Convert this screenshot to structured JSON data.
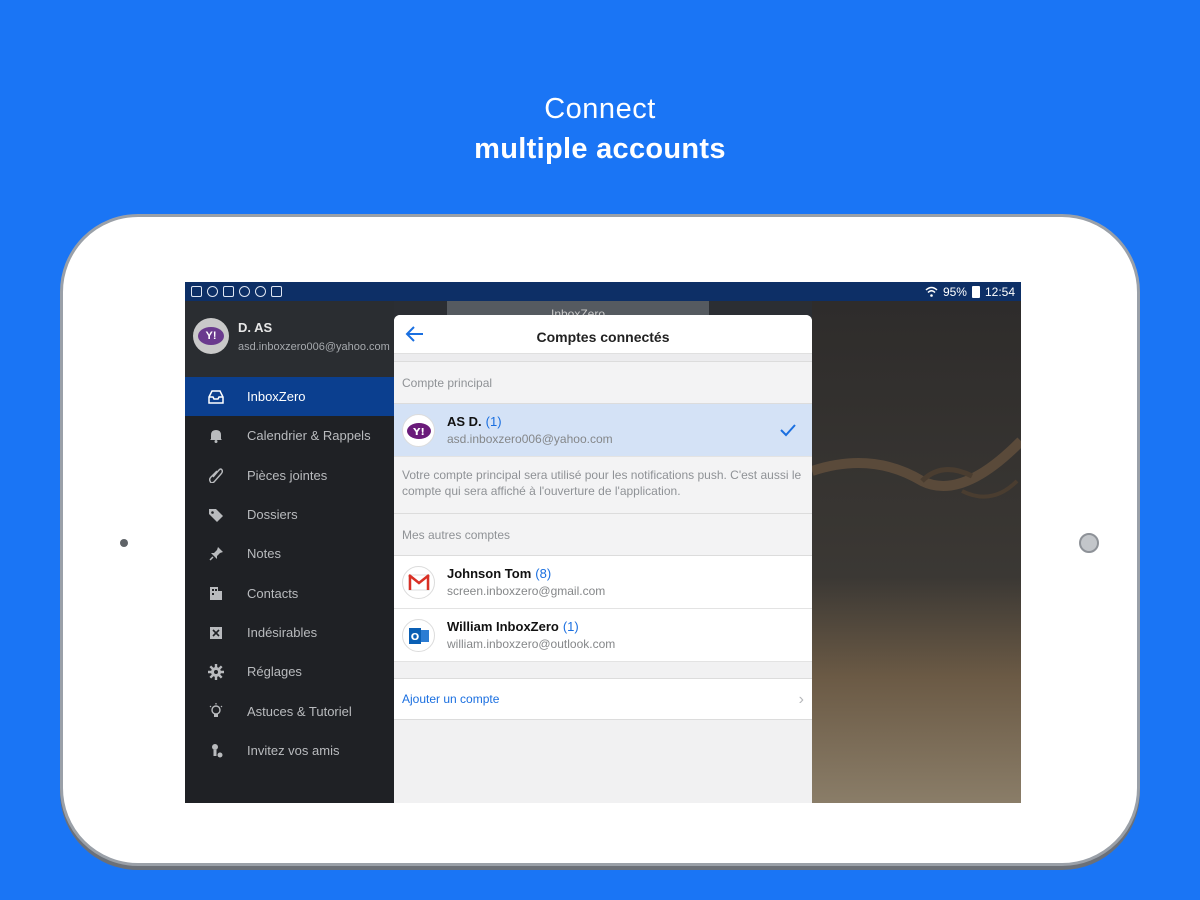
{
  "headline": {
    "line1": "Connect",
    "line2": "multiple accounts"
  },
  "status_bar": {
    "battery": "95%",
    "time": "12:54"
  },
  "background": {
    "title": "InboxZero"
  },
  "drawer": {
    "name": "D. AS",
    "email": "asd.inboxzero006@yahoo.com",
    "avatar_text": "Y!",
    "items": [
      {
        "label": "InboxZero",
        "icon": "inbox-icon"
      },
      {
        "label": "Calendrier & Rappels",
        "icon": "bell-icon"
      },
      {
        "label": "Pièces jointes",
        "icon": "paperclip-icon"
      },
      {
        "label": "Dossiers",
        "icon": "tag-icon"
      },
      {
        "label": "Notes",
        "icon": "pin-icon"
      },
      {
        "label": "Contacts",
        "icon": "contacts-icon"
      },
      {
        "label": "Indésirables",
        "icon": "spam-icon"
      },
      {
        "label": "Réglages",
        "icon": "gear-icon"
      },
      {
        "label": "Astuces & Tutoriel",
        "icon": "lightbulb-icon"
      },
      {
        "label": "Invitez vos amis",
        "icon": "invite-icon"
      }
    ]
  },
  "dialog": {
    "title": "Comptes connectés",
    "primary_label": "Compte principal",
    "primary": {
      "name": "AS D.",
      "count": "(1)",
      "email": "asd.inboxzero006@yahoo.com",
      "logo_text": "Y!"
    },
    "note": "Votre compte principal sera utilisé pour les notifications push. C'est aussi le compte qui sera affiché à l'ouverture de l'application.",
    "others_label": "Mes autres comptes",
    "others": [
      {
        "name": "Johnson Tom",
        "count": "(8)",
        "email": "screen.inboxzero@gmail.com",
        "logo_text": "M"
      },
      {
        "name": "William InboxZero",
        "count": "(1)",
        "email": "william.inboxzero@outlook.com",
        "logo_text": "O"
      }
    ],
    "add_account": "Ajouter un compte"
  },
  "colors": {
    "brand_blue": "#1a75f5",
    "accent": "#1a6fe0",
    "drawer_active": "#0b3f8f"
  }
}
